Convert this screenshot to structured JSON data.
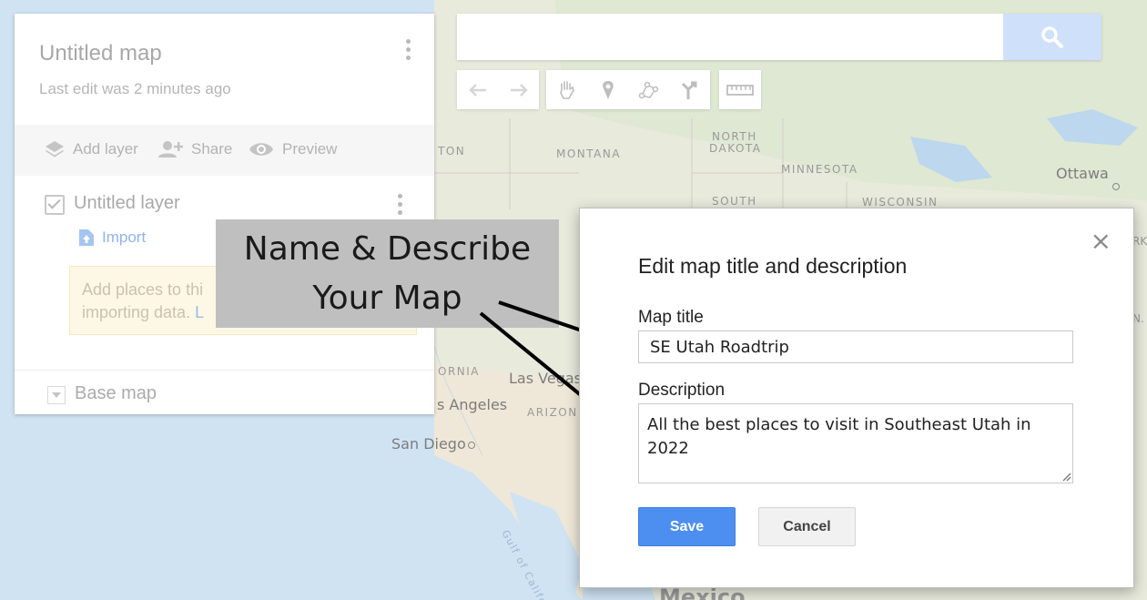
{
  "map": {
    "labels": {
      "montana": "MONTANA",
      "north_dakota_1": "NORTH",
      "north_dakota_2": "DAKOTA",
      "minnesota": "MINNESOTA",
      "south": "SOUTH",
      "wisconsin": "WISCONSIN",
      "ton": "TON",
      "ornia": "ORNIA",
      "arizon": "ARIZON",
      "rk": "RK",
      "n": "N.",
      "gulf": "Gulf of California"
    },
    "cities": {
      "ottawa": "Ottawa",
      "las_vegas": "Las Vegas",
      "los_angeles": "s Angeles",
      "san_diego": "San Diego",
      "mexico": "Mexico"
    }
  },
  "panel": {
    "title": "Untitled map",
    "subtitle": "Last edit was 2 minutes ago",
    "toolbar": {
      "add_layer": "Add layer",
      "share": "Share",
      "preview": "Preview"
    },
    "layer": {
      "name": "Untitled layer",
      "import": "Import",
      "tip_text": "Add places to this layer by drawing or importing data.",
      "tip_line1": "Add places to thi",
      "tip_line2": "importing data.",
      "tip_link": "L"
    },
    "base_map": "Base map"
  },
  "search": {
    "value": "",
    "placeholder": ""
  },
  "map_toolbar": {
    "icons": [
      "undo-icon",
      "redo-icon",
      "hand-icon",
      "marker-icon",
      "draw-line-icon",
      "directions-icon",
      "ruler-icon"
    ]
  },
  "callout": {
    "line1": "Name & Describe",
    "line2": "Your Map"
  },
  "dialog": {
    "title": "Edit map title and description",
    "map_title_label": "Map title",
    "map_title_value": "SE Utah Roadtrip",
    "description_label": "Description",
    "description_value": "All the best places to visit in Southeast Utah in 2022",
    "save_label": "Save",
    "cancel_label": "Cancel",
    "close_glyph": "×"
  },
  "colors": {
    "accent": "#4d8ff0",
    "callout_bg": "#bfbfbf",
    "tip_bg": "#fdf8e5"
  }
}
